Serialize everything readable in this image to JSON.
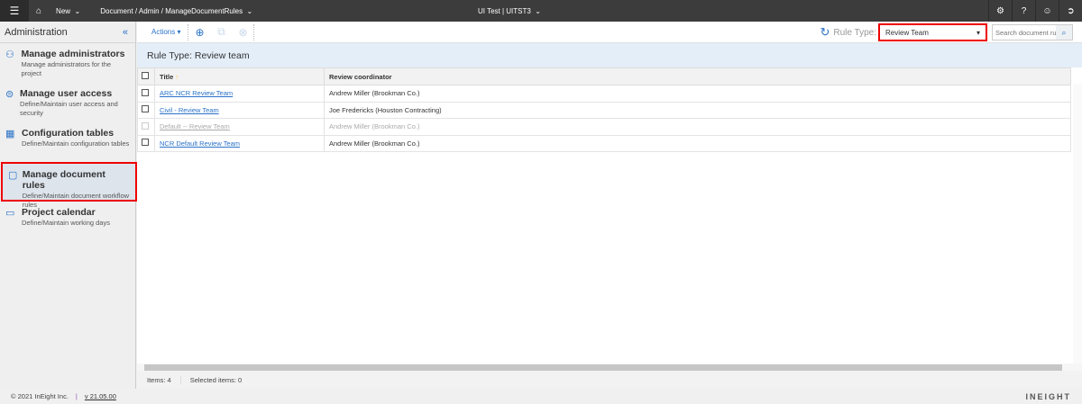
{
  "topbar": {
    "menu_icon": "hamburger-icon",
    "home_icon": "home-icon",
    "new_label": "New",
    "breadcrumb": "Document / Admin / ManageDocumentRules",
    "project": "UI Test | UITST3",
    "icons": [
      "gear-icon",
      "help-icon",
      "user-icon",
      "logout-icon"
    ]
  },
  "sidebar": {
    "title": "Administration",
    "collapse": "«",
    "items": [
      {
        "title": "Manage administrators",
        "desc": "Manage administrators for the project",
        "icon": "users-icon"
      },
      {
        "title": "Manage user access",
        "desc": "Define/Maintain user access and security",
        "icon": "globe-icon"
      },
      {
        "title": "Configuration tables",
        "desc": "Define/Maintain configuration tables",
        "icon": "grid-icon"
      },
      {
        "title": "Manage document rules",
        "desc": "Define/Maintain document workflow rules",
        "icon": "document-icon",
        "selected": true
      },
      {
        "title": "Project calendar",
        "desc": "Define/Maintain working days",
        "icon": "calendar-icon"
      }
    ]
  },
  "toolbar": {
    "actions_label": "Actions",
    "rule_type_label": "Rule Type:",
    "rule_type_value": "Review Team",
    "search_placeholder": "Search document ru"
  },
  "banner": "Rule Type: Review team",
  "table": {
    "columns": [
      "Title",
      "Review coordinator"
    ],
    "rows": [
      {
        "title": "ARC NCR Review Team",
        "coordinator": "Andrew Miller (Brookman Co.)",
        "disabled": false
      },
      {
        "title": "Civil - Review Team",
        "coordinator": "Joe Fredericks (Houston Contracting)",
        "disabled": false
      },
      {
        "title": "Default -- Review Team",
        "coordinator": "Andrew Miller (Brookman Co.)",
        "disabled": true
      },
      {
        "title": "NCR Default Review Team",
        "coordinator": "Andrew Miller (Brookman Co.)",
        "disabled": false
      }
    ]
  },
  "status": {
    "items": "Items: 4",
    "selected": "Selected items: 0"
  },
  "footer": {
    "copyright": "© 2021 InEight Inc.",
    "separator": "|",
    "version": "v 21.05.00",
    "logo": "INEIGHT"
  }
}
